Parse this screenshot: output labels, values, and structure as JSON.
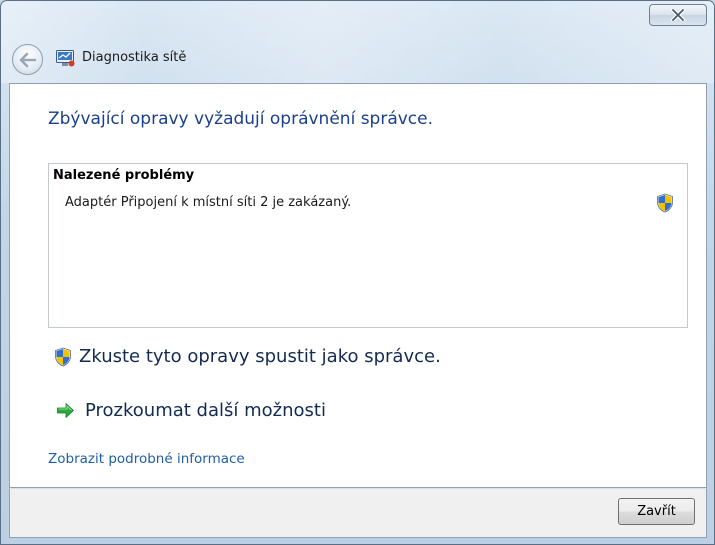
{
  "window": {
    "title": "Diagnostika sítě",
    "close_glyph": "X"
  },
  "content": {
    "heading": "Zbývající opravy vyžadují oprávnění správce.",
    "problems": {
      "header": "Nalezené problémy",
      "items": [
        {
          "text": "Adaptér Připojení k místní síti 2 je zakázaný.",
          "icon": "uac-shield-icon"
        }
      ]
    },
    "actions": {
      "run_as_admin": {
        "label": "Zkuste tyto opravy spustit jako správce.",
        "icon": "uac-shield-icon"
      },
      "explore": {
        "label": "Prozkoumat další možnosti",
        "icon": "green-arrow-icon"
      }
    },
    "details_link": "Zobrazit podrobné informace"
  },
  "footer": {
    "close_button": "Zavřít"
  },
  "colors": {
    "heading": "#1a3f8f",
    "link": "#1f5fa8",
    "shield_blue": "#2f6fd0",
    "shield_yellow": "#f2c200",
    "arrow_green": "#2aa83a"
  }
}
